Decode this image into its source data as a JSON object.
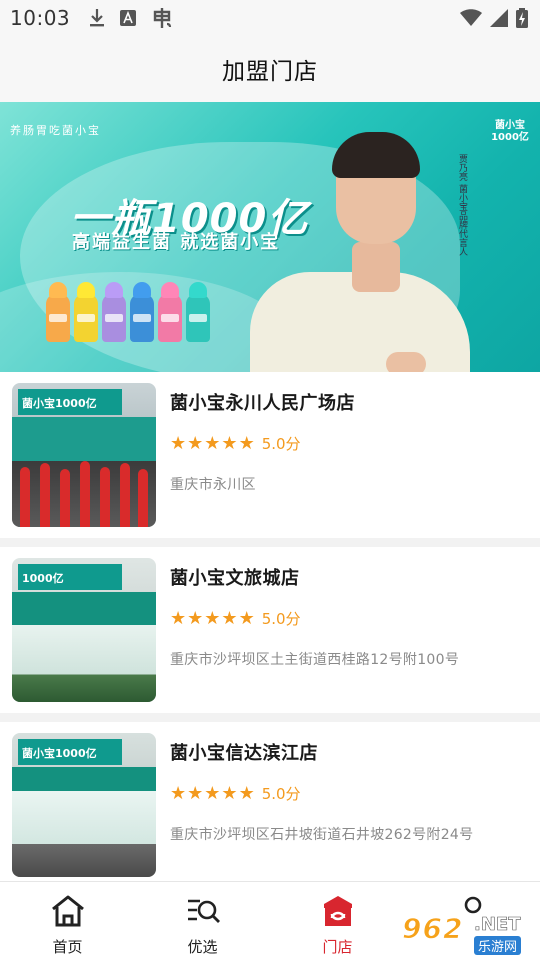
{
  "status_bar": {
    "time": "10:03",
    "left_icons": [
      "download-icon",
      "font-a-icon",
      "app-notification-icon"
    ],
    "right_icons": [
      "wifi-icon",
      "signal-icon",
      "battery-charging-icon"
    ]
  },
  "header": {
    "title": "加盟门店"
  },
  "banner": {
    "tagline": "养肠胃吃菌小宝",
    "logo": "菌小宝1000亿",
    "headline": "一瓶1000亿",
    "subline": "高端益生菌 就选菌小宝",
    "endorser": "贾乃亮 菌小宝品牌代言人"
  },
  "stores": [
    {
      "name": "菌小宝永川人民广场店",
      "stars": 5,
      "score": "5.0分",
      "address": "重庆市永川区",
      "sign": "菌小宝1000亿"
    },
    {
      "name": "菌小宝文旅城店",
      "stars": 5,
      "score": "5.0分",
      "address": "重庆市沙坪坝区土主街道西桂路12号附100号",
      "sign": "1000亿"
    },
    {
      "name": "菌小宝信达滨江店",
      "stars": 5,
      "score": "5.0分",
      "address": "重庆市沙坪坝区石井坡街道石井坡262号附24号",
      "sign": "菌小宝1000亿"
    }
  ],
  "bottom_nav": {
    "items": [
      {
        "label": "首页",
        "icon": "home-icon"
      },
      {
        "label": "优选",
        "icon": "search-list-icon"
      },
      {
        "label": "门店",
        "icon": "store-icon",
        "active": true
      },
      {
        "label": "",
        "icon": "profile-icon"
      }
    ]
  },
  "watermark": {
    "badge": "962",
    "net": ".NET",
    "sub": "乐游网"
  },
  "colors": {
    "accent": "#d8262f",
    "star": "#f39a1e",
    "banner": "#13b3ad"
  }
}
